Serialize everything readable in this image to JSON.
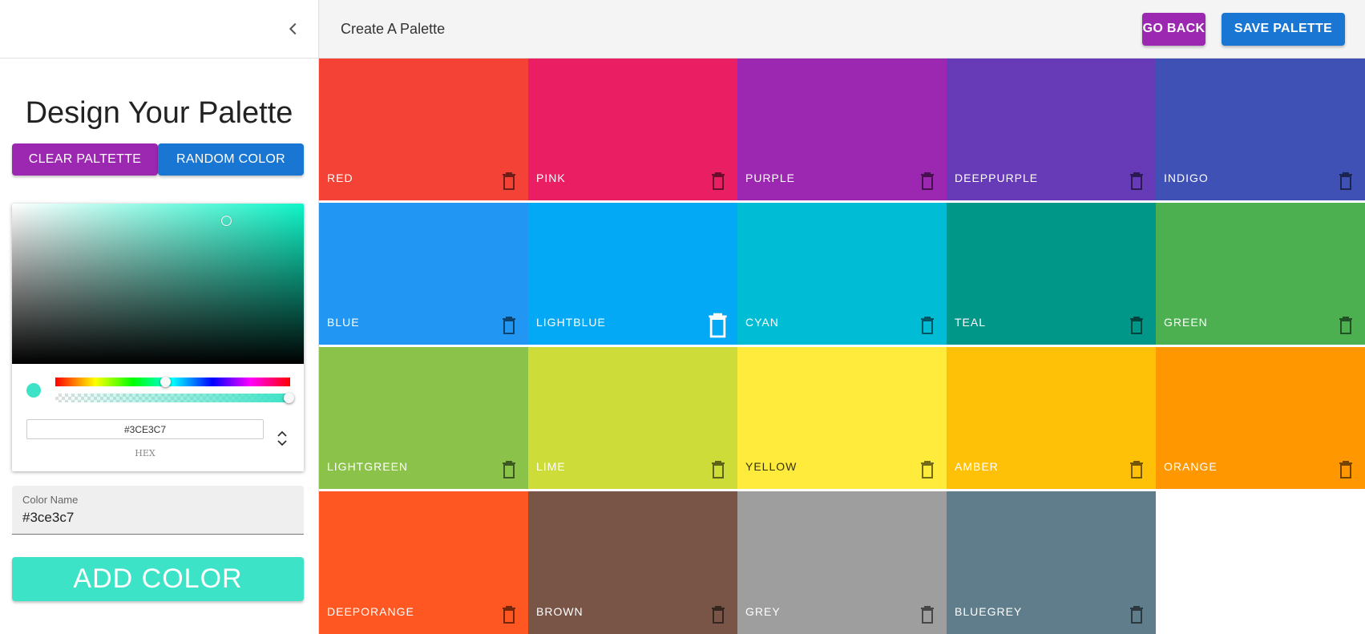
{
  "topbar": {
    "title": "Create A Palette",
    "go_back": "GO BACK",
    "save": "SAVE PALETTE"
  },
  "sidebar": {
    "heading": "Design Your Palette",
    "clear_label": "CLEAR PALTETTE",
    "random_label": "RANDOM COLOR",
    "picker": {
      "hex_value": "#3CE3C7",
      "hex_label": "HEX",
      "current_color": "#3ce3c7"
    },
    "color_name": {
      "label": "Color Name",
      "value": "#3ce3c7"
    },
    "add_label": "ADD COLOR"
  },
  "colors": [
    {
      "name": "RED",
      "color": "#f44336"
    },
    {
      "name": "PINK",
      "color": "#e91e63"
    },
    {
      "name": "PURPLE",
      "color": "#9c27b0"
    },
    {
      "name": "DEEPPURPLE",
      "color": "#673ab7"
    },
    {
      "name": "INDIGO",
      "color": "#3f51b5"
    },
    {
      "name": "BLUE",
      "color": "#2196f3"
    },
    {
      "name": "LIGHTBLUE",
      "color": "#03a9f4"
    },
    {
      "name": "CYAN",
      "color": "#00bcd4"
    },
    {
      "name": "TEAL",
      "color": "#009688"
    },
    {
      "name": "GREEN",
      "color": "#4caf50"
    },
    {
      "name": "LIGHTGREEN",
      "color": "#8bc34a"
    },
    {
      "name": "LIME",
      "color": "#cddc39"
    },
    {
      "name": "YELLOW",
      "color": "#ffeb3b"
    },
    {
      "name": "AMBER",
      "color": "#ffc107"
    },
    {
      "name": "ORANGE",
      "color": "#ff9800"
    },
    {
      "name": "DEEPORANGE",
      "color": "#ff5722"
    },
    {
      "name": "BROWN",
      "color": "#795548"
    },
    {
      "name": "GREY",
      "color": "#9e9e9e"
    },
    {
      "name": "BLUEGREY",
      "color": "#607d8b"
    }
  ]
}
